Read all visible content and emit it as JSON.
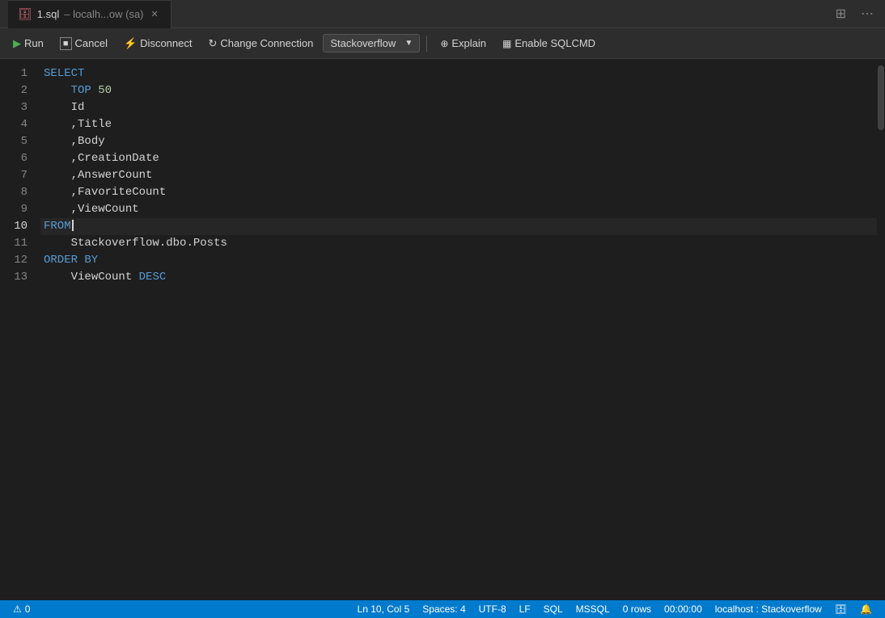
{
  "titleBar": {
    "tabIcon": "🗄",
    "tabName": "1.sql",
    "tabSubtitle": "localh...ow (sa)",
    "layoutIcon": "⊞",
    "moreIcon": "⋯"
  },
  "toolbar": {
    "runLabel": "Run",
    "cancelLabel": "Cancel",
    "disconnectLabel": "Disconnect",
    "changeConnectionLabel": "Change Connection",
    "connectionName": "Stackoverflow",
    "explainLabel": "Explain",
    "enableSqlcmdLabel": "Enable SQLCMD"
  },
  "editor": {
    "lines": [
      {
        "num": 1,
        "content": "SELECT",
        "type": "code"
      },
      {
        "num": 2,
        "content": "    TOP 50",
        "type": "code"
      },
      {
        "num": 3,
        "content": "    Id",
        "type": "code"
      },
      {
        "num": 4,
        "content": "    ,Title",
        "type": "code"
      },
      {
        "num": 5,
        "content": "    ,Body",
        "type": "code"
      },
      {
        "num": 6,
        "content": "    ,CreationDate",
        "type": "code"
      },
      {
        "num": 7,
        "content": "    ,AnswerCount",
        "type": "code"
      },
      {
        "num": 8,
        "content": "    ,FavoriteCount",
        "type": "code"
      },
      {
        "num": 9,
        "content": "    ,ViewCount",
        "type": "code"
      },
      {
        "num": 10,
        "content": "FROM",
        "type": "active"
      },
      {
        "num": 11,
        "content": "    Stackoverflow.dbo.Posts",
        "type": "code"
      },
      {
        "num": 12,
        "content": "ORDER BY",
        "type": "code"
      },
      {
        "num": 13,
        "content": "    ViewCount DESC",
        "type": "code"
      }
    ]
  },
  "statusBar": {
    "warningIcon": "⚠",
    "warningCount": "0",
    "position": "Ln 10, Col 5",
    "spaces": "Spaces: 4",
    "encoding": "UTF-8",
    "lineEnding": "LF",
    "language": "SQL",
    "dialect": "MSSQL",
    "rows": "0 rows",
    "time": "00:00:00",
    "connection": "localhost : Stackoverflow",
    "notifyIcon": "🔔",
    "dbIcon": "🗄"
  }
}
